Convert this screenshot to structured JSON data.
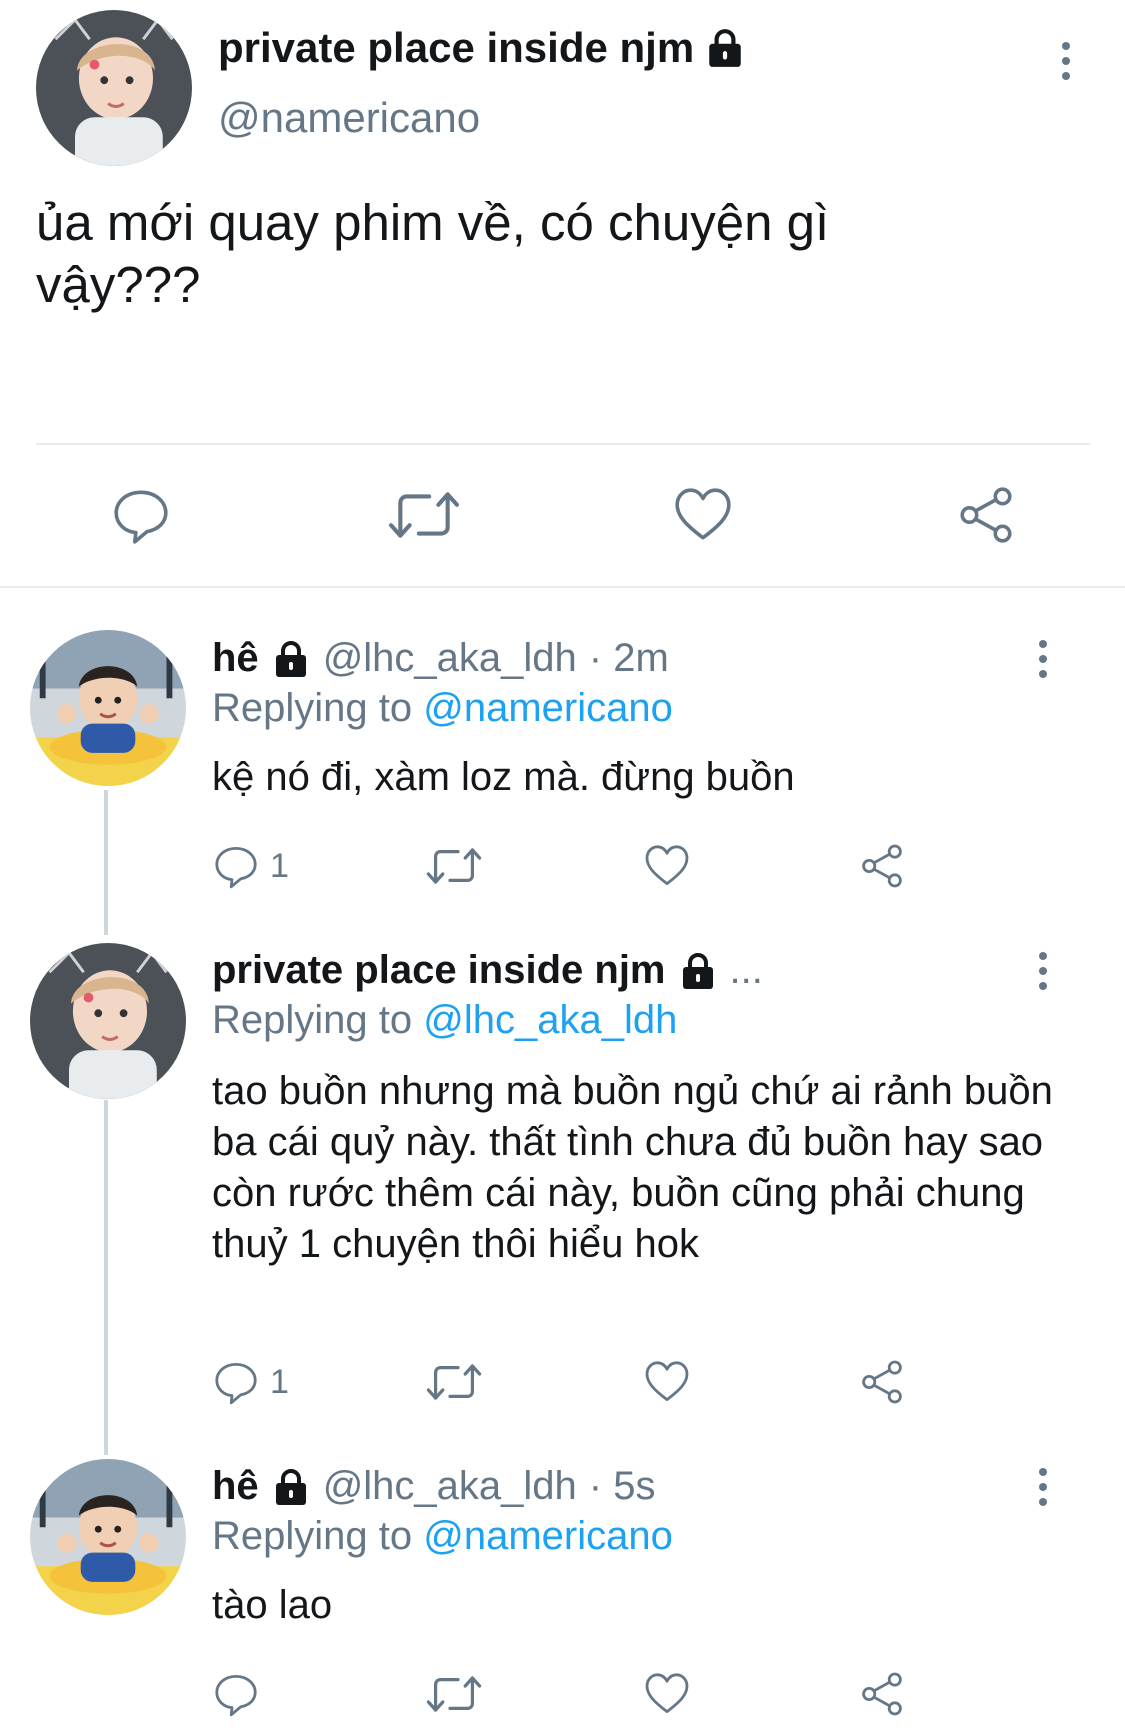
{
  "main_tweet": {
    "display_name": "private place inside njm",
    "handle": "@namericano",
    "text": "ủa mới quay phim về, có chuyện gì vậy???",
    "lock_icon": "lock-icon",
    "more_icon": "vertical-dots-icon"
  },
  "actions": {
    "reply_icon": "reply-bubble-icon",
    "retweet_icon": "retweet-icon",
    "like_icon": "heart-icon",
    "share_icon": "share-icon"
  },
  "replies": [
    {
      "display_name": "hê",
      "handle": "@lhc_aka_ldh",
      "time": "· 2m",
      "replying_prefix": "Replying to",
      "replying_to": "@namericano",
      "text": "kệ nó đi, xàm loz mà. đừng buồn",
      "reply_count": "1"
    },
    {
      "display_name": "private place inside njm",
      "handle": "...",
      "time": "",
      "replying_prefix": "Replying to",
      "replying_to": "@lhc_aka_ldh",
      "text": "tao buồn nhưng mà buồn ngủ chứ ai rảnh buồn ba cái quỷ này. thất tình chưa đủ buồn hay sao còn rước thêm cái này, buồn cũng phải chung thuỷ 1 chuyện thôi hiểu hok",
      "reply_count": "1"
    },
    {
      "display_name": "hê",
      "handle": "@lhc_aka_ldh",
      "time": "· 5s",
      "replying_prefix": "Replying to",
      "replying_to": "@namericano",
      "text": "tào lao",
      "reply_count": ""
    }
  ],
  "colors": {
    "text": "#14171a",
    "secondary": "#657786",
    "link": "#1da1f2",
    "divider": "#e6ecf0"
  }
}
